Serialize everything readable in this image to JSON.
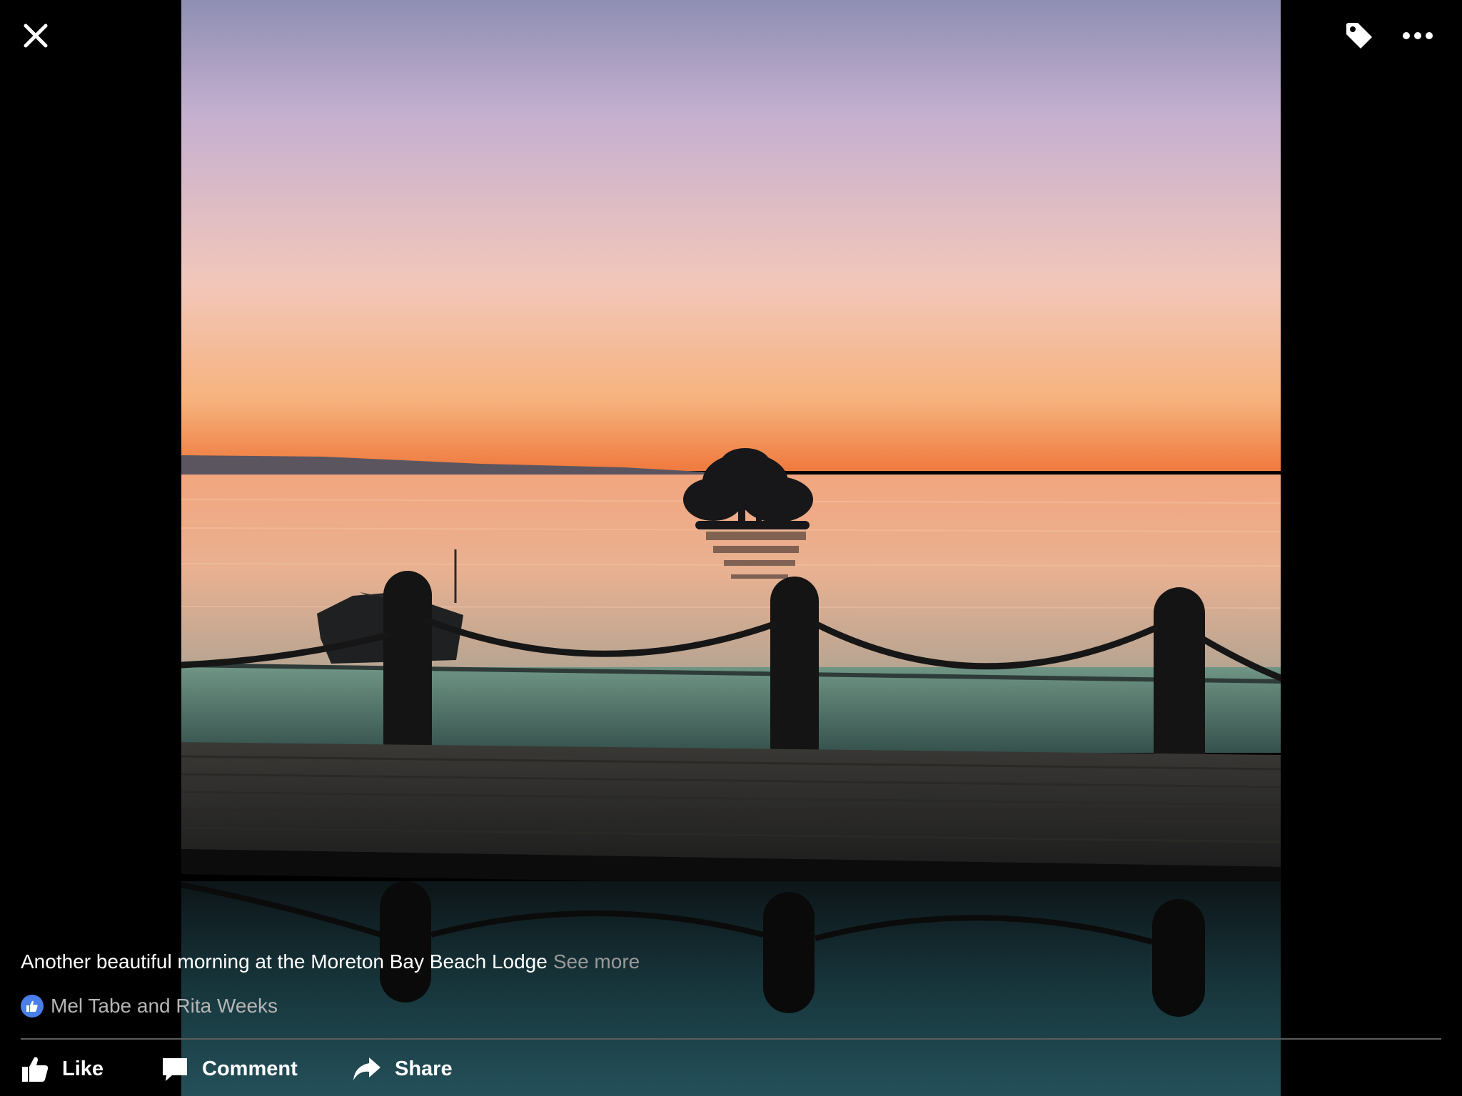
{
  "viewer": {
    "close_icon": "close-icon",
    "tag_icon": "tag-icon",
    "more_icon": "more-options-icon"
  },
  "photo": {
    "description_icon": "sunset-photo"
  },
  "caption": {
    "text": "Another beautiful morning at the Moreton Bay Beach Lodge",
    "see_more": "See more"
  },
  "reactions": {
    "icon": "thumbs-up-icon",
    "names": "Mel Tabe and Rita Weeks"
  },
  "actions": {
    "like": "Like",
    "comment": "Comment",
    "share": "Share"
  },
  "colors": {
    "background": "#000000",
    "like_badge": "#4a7ee8",
    "see_more": "#9a9a9a",
    "divider": "#5c5c5c"
  }
}
